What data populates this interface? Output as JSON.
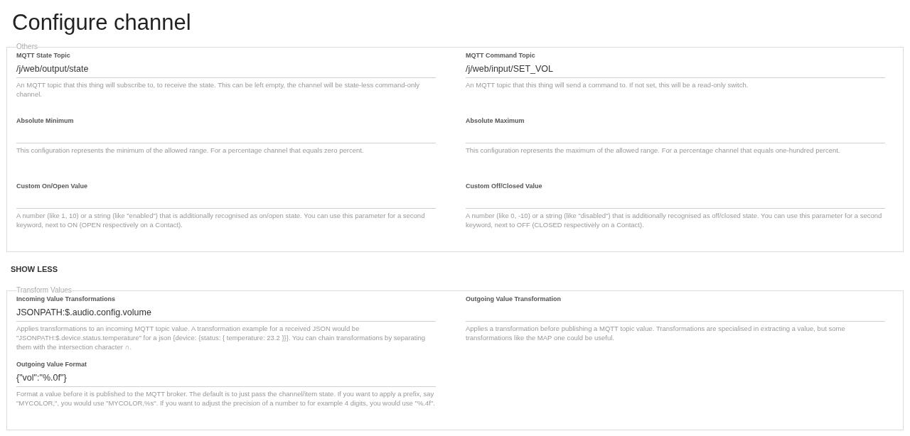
{
  "title": "Configure channel",
  "sections": [
    {
      "legend": "Others",
      "left": [
        {
          "label": "MQTT State Topic",
          "value": "/j/web/output/state",
          "description": "An MQTT topic that this thing will subscribe to, to receive the state. This can be left empty, the channel will be state-less command-only channel."
        },
        {
          "label": "Absolute Minimum",
          "description": "This configuration represents the minimum of the allowed range. For a percentage channel that equals zero percent."
        },
        {
          "label": "Custom On/Open Value",
          "description": "A number (like 1, 10) or a string (like \"enabled\") that is additionally recognised as on/open state. You can use this parameter for a second keyword, next to ON (OPEN respectively on a Contact)."
        }
      ],
      "right": [
        {
          "label": "MQTT Command Topic",
          "value": "/j/web/input/SET_VOL",
          "description": "An MQTT topic that this thing will send a command to. If not set, this will be a read-only switch."
        },
        {
          "label": "Absolute Maximum",
          "description": "This configuration represents the maximum of the allowed range. For a percentage channel that equals one-hundred percent."
        },
        {
          "label": "Custom Off/Closed Value",
          "description": "A number (like 0, -10) or a string (like \"disabled\") that is additionally recognised as off/closed state. You can use this parameter for a second keyword, next to OFF (CLOSED respectively on a Contact)."
        }
      ]
    },
    {
      "legend": "Transform Values",
      "left": [
        {
          "label": "Incoming Value Transformations",
          "value": "JSONPATH:$.audio.config.volume",
          "description": "Applies transformations to an incoming MQTT topic value. A transformation example for a received JSON would be \"JSONPATH:$.device.status.temperature\" for a json {device: {status: { temperature: 23.2 }}}. You can chain transformations by separating them with the intersection character ∩."
        },
        {
          "label": "Outgoing Value Format",
          "value": "{\"vol\":\"%.0f\"}",
          "description": "Format a value before it is published to the MQTT broker. The default is to just pass the channel/item state. If you want to apply a prefix, say \"MYCOLOR,\", you would use \"MYCOLOR,%s\". If you want to adjust the precision of a number to for example 4 digits, you would use \"%.4f\"."
        }
      ],
      "right": [
        {
          "label": "Outgoing Value Transformation",
          "description": "Applies a transformation before publishing a MQTT topic value. Transformations are specialised in extracting a value, but some transformations like the MAP one could be useful."
        }
      ]
    }
  ],
  "toggle_button": "SHOW LESS"
}
